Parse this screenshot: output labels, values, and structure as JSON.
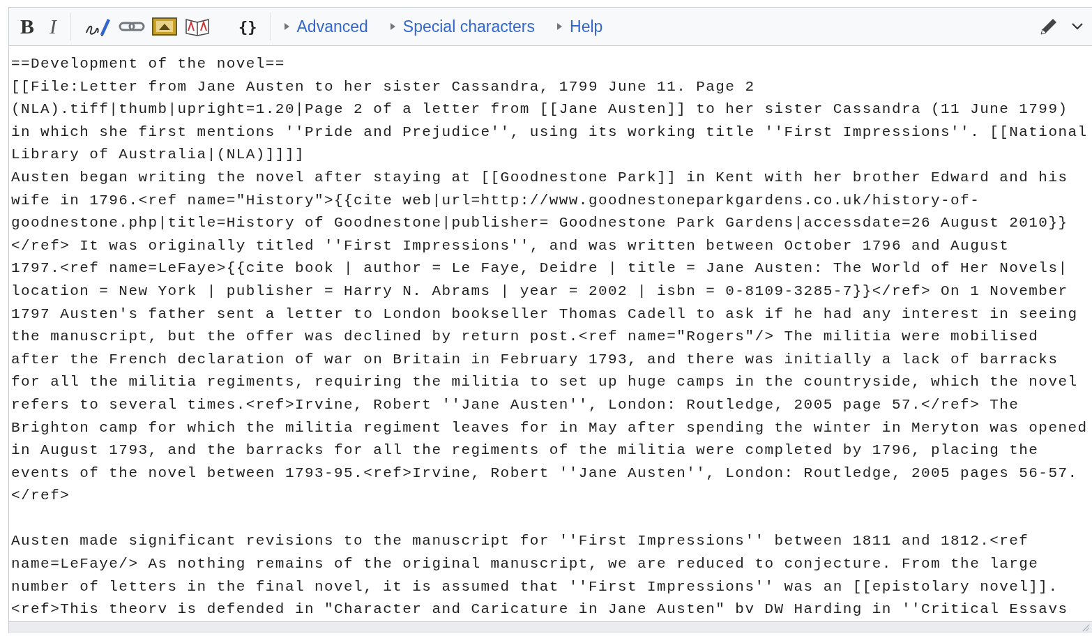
{
  "toolbar": {
    "bold": "B",
    "italic": "I",
    "braces": "{}",
    "sections": [
      {
        "label": "Advanced",
        "expanded": false
      },
      {
        "label": "Special characters",
        "expanded": false
      },
      {
        "label": "Help",
        "expanded": false
      }
    ]
  },
  "editor": {
    "paragraphs": [
      {
        "lines": [
          "==Development of the novel==",
          "[[File:Letter from Jane Austen to her sister Cassandra, 1799 June 11. Page 2",
          "(NLA).tiff|thumb|upright=1.20|Page 2 of a letter from [[Jane Austen]] to her sister Cassandra (11 June 1799)",
          "in which she first mentions ''Pride and Prejudice'', using its working title ''First Impressions''. [[National",
          "Library of Australia|(NLA)]]]]",
          "Austen began writing the novel after staying at [[Goodnestone Park]] in Kent with her brother Edward and his",
          "wife in 1796.<ref name=\"History\">{{cite web|url=http://www.goodnestoneparkgardens.co.uk/history-of-",
          "goodnestone.php|title=History of Goodnestone|publisher= Goodnestone Park Gardens|accessdate=26 August 2010}}",
          "</ref> It was originally titled ''First Impressions'', and was written between October 1796 and August",
          "1797.<ref name=LeFaye>{{cite book | author = Le Faye, Deidre | title = Jane Austen: The World of Her Novels|",
          "location = New York | publisher = Harry N. Abrams | year = 2002 | isbn = 0-8109-3285-7}}</ref> On 1 November",
          "1797 Austen's father sent a letter to London bookseller Thomas Cadell to ask if he had any interest in seeing",
          "the manuscript, but the offer was declined by return post.<ref name=\"Rogers\"/> The militia were mobilised",
          "after the French declaration of war on Britain in February 1793, and there was initially a lack of barracks",
          "for all the militia regiments, requiring the militia to set up huge camps in the countryside, which the novel",
          "refers to several times.<ref>Irvine, Robert ''Jane Austen'', London: Routledge, 2005 page 57.</ref> The",
          "Brighton camp for which the militia regiment leaves for in May after spending the winter in Meryton was opened",
          "in August 1793, and the barracks for all the regiments of the militia were completed by 1796, placing the",
          "events of the novel between 1793-95.<ref>Irvine, Robert ''Jane Austen'', London: Routledge, 2005 pages 56-57.",
          "</ref>"
        ]
      },
      {
        "lines": [
          "Austen made significant revisions to the manuscript for ''First Impressions'' between 1811 and 1812.<ref",
          "name=LeFaye/> As nothing remains of the original manuscript, we are reduced to conjecture. From the large",
          "number of letters in the final novel, it is assumed that ''First Impressions'' was an [[epistolary novel]].",
          "<ref>This theorv is defended in \"Character and Caricature in Jane Austen\" bv DW Harding in ''Critical Essavs"
        ]
      }
    ]
  }
}
